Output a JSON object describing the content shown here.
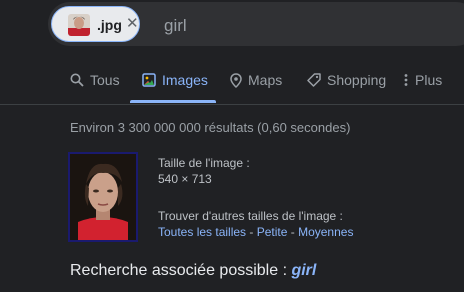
{
  "search": {
    "chip_label": ".jpg",
    "query": "girl"
  },
  "tabs": [
    {
      "label": "Tous",
      "icon": "search-icon"
    },
    {
      "label": "Images",
      "icon": "images-icon",
      "active": true
    },
    {
      "label": "Maps",
      "icon": "map-pin-icon"
    },
    {
      "label": "Shopping",
      "icon": "tag-icon"
    },
    {
      "label": "Plus",
      "icon": "more-vertical-icon"
    }
  ],
  "results": {
    "stats": "Environ 3 300 000 000 résultats (0,60 secondes)",
    "image_size_label": "Taille de l'image :",
    "image_size": "540 × 713",
    "other_sizes_label": "Trouver d'autres tailles de l'image :",
    "size_links": [
      "Toutes les tailles",
      "Petite",
      "Moyennes"
    ],
    "separator": " - ",
    "related_label": "Recherche associée possible : ",
    "related_query": "girl"
  },
  "colors": {
    "background": "#202124",
    "accent": "#8ab4f8",
    "text": "#bdc1c6"
  }
}
